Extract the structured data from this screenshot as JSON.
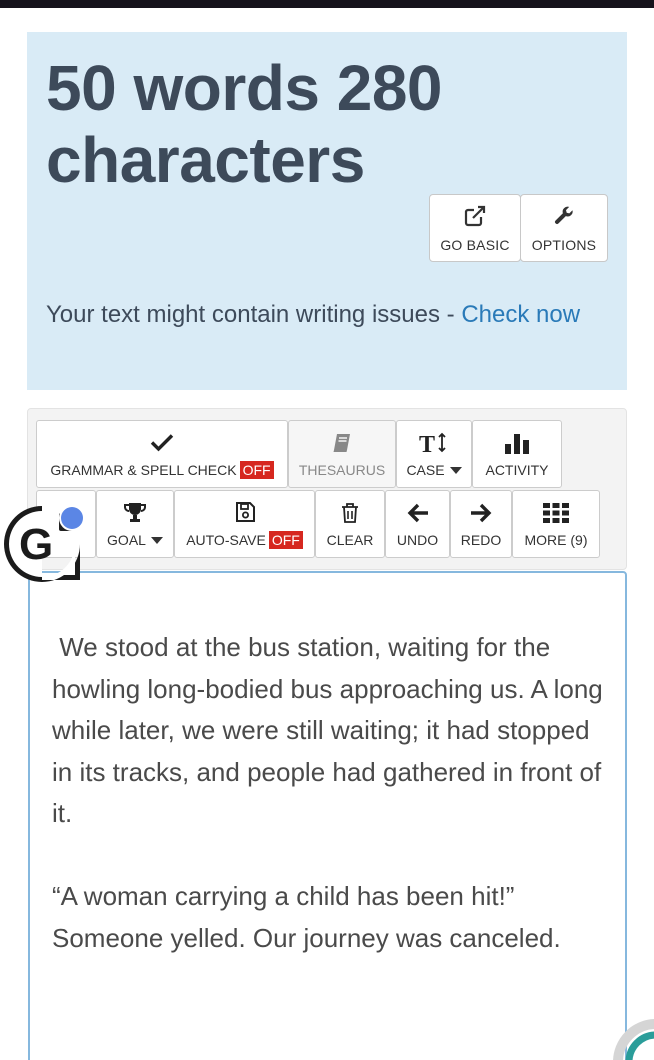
{
  "header": {
    "count_title": "50 words 280 characters",
    "go_basic_label": "GO BASIC",
    "options_label": "OPTIONS",
    "issues_text": "Your text might contain writing issues - ",
    "issues_link": "Check now"
  },
  "toolbar": {
    "grammar_label": "GRAMMAR & SPELL CHECK",
    "grammar_state": "OFF",
    "thesaurus_label": "THESAURUS",
    "case_label": "CASE",
    "activity_label": "ACTIVITY",
    "goal_label": "GOAL",
    "autosave_label": "AUTO-SAVE",
    "autosave_state": "OFF",
    "clear_label": "CLEAR",
    "undo_label": "UNDO",
    "redo_label": "REDO",
    "more_label": "MORE (9)"
  },
  "editor": {
    "text": " We stood at the bus station, waiting for the howling long-bodied bus approaching us. A long while later, we were still waiting; it had stopped in its tracks, and people had gathered in front of it.\n\n“A woman carrying a child has been hit!” Someone yelled. Our journey was canceled."
  },
  "colors": {
    "panel_bg": "#d9ebf6",
    "title": "#3d4a5a",
    "link": "#2a7ab8",
    "off_badge": "#d6271f",
    "editor_border": "#86b8de",
    "grammarly_dot": "#5b86e5"
  },
  "icons": {
    "go_basic": "external-link-icon",
    "options": "wrench-icon",
    "grammar": "check-icon",
    "thesaurus": "book-icon",
    "case": "text-height-icon",
    "activity": "bar-chart-icon",
    "goal": "trophy-icon",
    "autosave": "floppy-disk-icon",
    "clear": "trash-icon",
    "undo": "arrow-left-icon",
    "redo": "arrow-right-icon",
    "more": "grid-icon"
  }
}
